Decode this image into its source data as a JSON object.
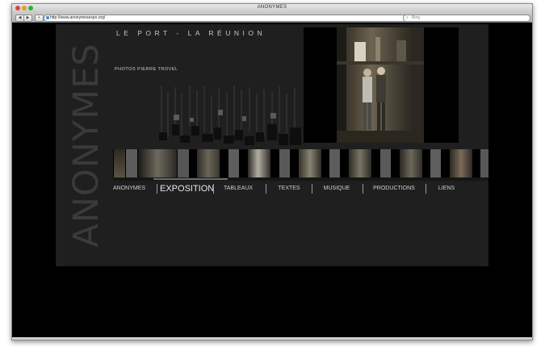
{
  "browser": {
    "window_title": "ANONYMES",
    "url": "http://www.anonymesexpo.org/",
    "search_placeholder": "Bing",
    "back_glyph": "◀",
    "forward_glyph": "▶",
    "add_glyph": "+",
    "reload_glyph": "↻",
    "search_glyph": "⌕"
  },
  "site": {
    "vertical_title": "ANONYMES",
    "location": "LE PORT - LA RÉUNION",
    "credits": "PHOTOS PIERRE TROVEL",
    "nav": [
      {
        "label": "ANONYMES",
        "active": false
      },
      {
        "label": "EXPOSITION",
        "active": true
      },
      {
        "label": "TABLEAUX",
        "active": false
      },
      {
        "label": "TEXTES",
        "active": false
      },
      {
        "label": "MUSIQUE",
        "active": false
      },
      {
        "label": "PRODUCTIONS",
        "active": false
      },
      {
        "label": "LIENS",
        "active": false
      }
    ]
  },
  "colors": {
    "site_bg": "#1f1f1f",
    "page_bg": "#000000",
    "nav_text": "#cfcfcf"
  }
}
